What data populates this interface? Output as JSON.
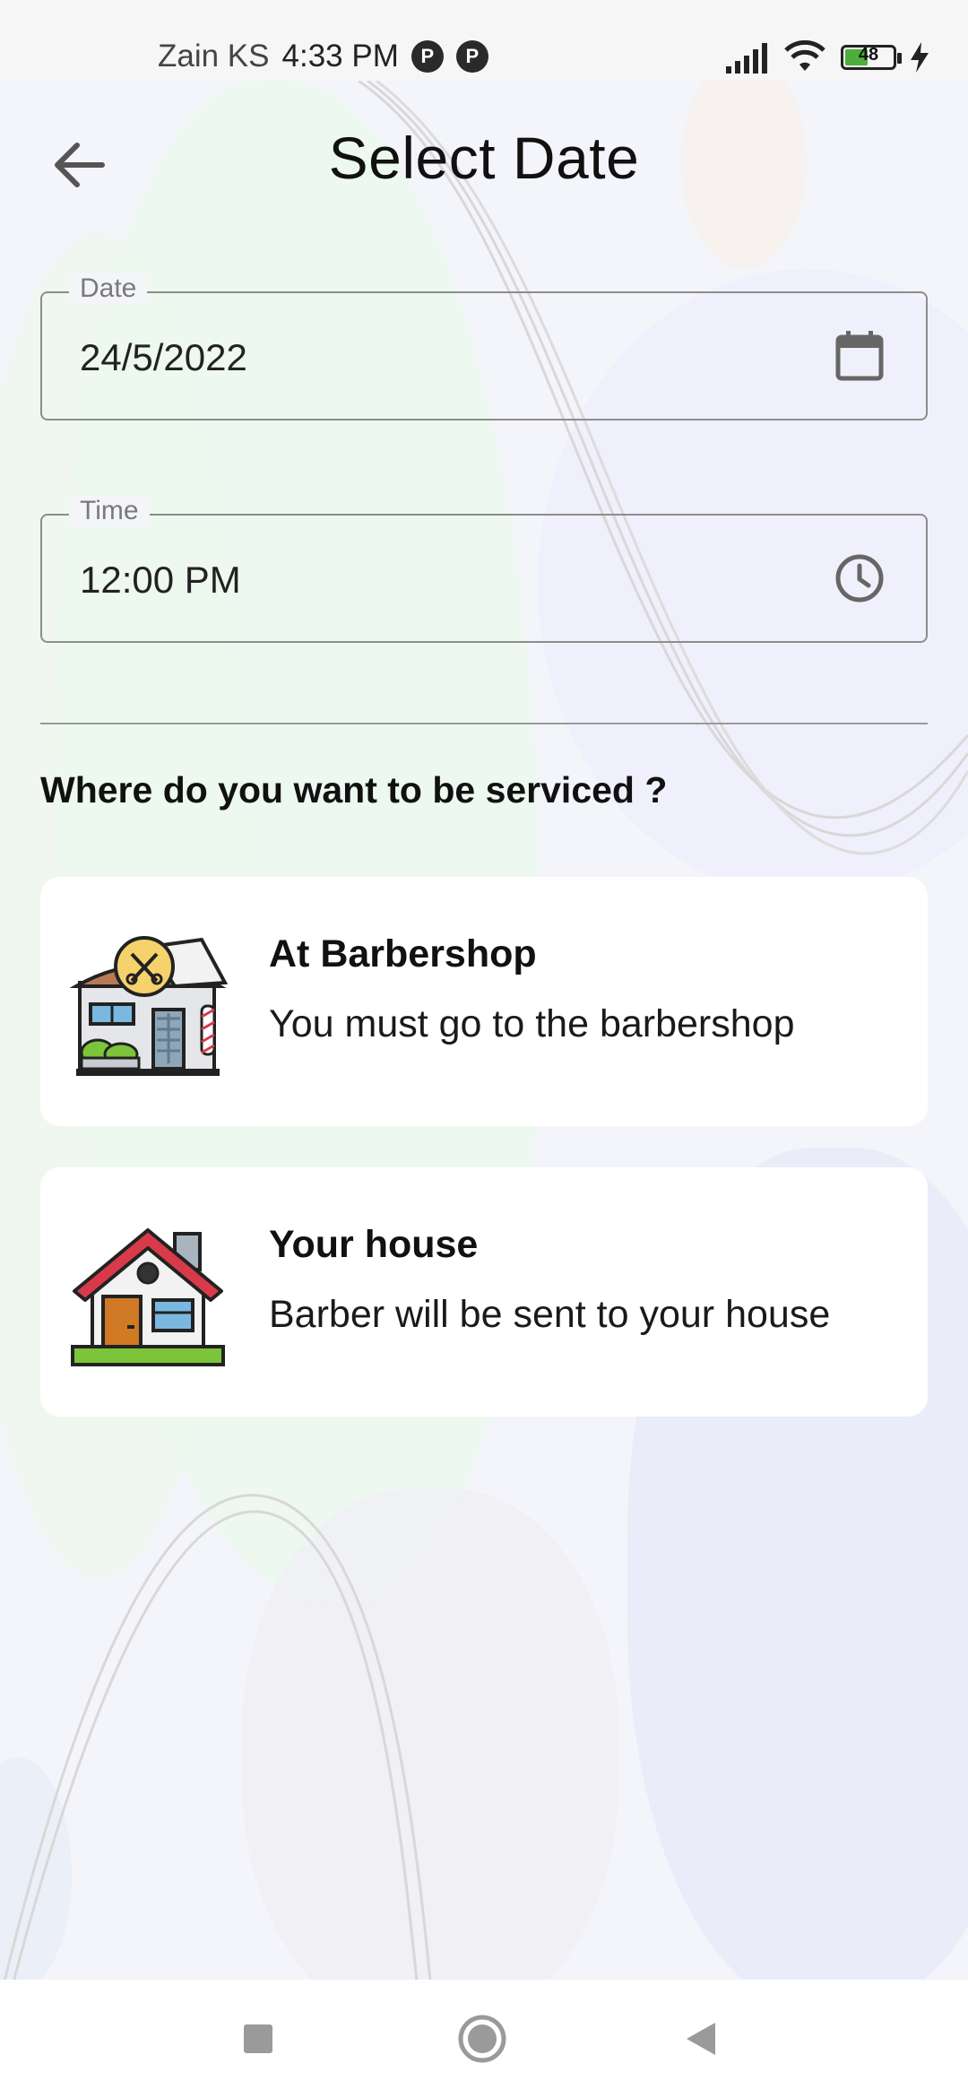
{
  "status_bar": {
    "carrier": "Zain KS",
    "time": "4:33 PM",
    "battery": "48"
  },
  "header": {
    "title": "Select Date",
    "back_icon": "arrow-left-icon"
  },
  "date_field": {
    "label": "Date",
    "value": "24/5/2022",
    "icon": "calendar-icon"
  },
  "time_field": {
    "label": "Time",
    "value": "12:00 PM",
    "icon": "clock-icon"
  },
  "question": "Where do you want to be serviced ?",
  "options": [
    {
      "title": "At Barbershop",
      "subtitle": "You must go to the barbershop",
      "icon": "barbershop-icon"
    },
    {
      "title": "Your house",
      "subtitle": "Barber will be sent to your house",
      "icon": "house-icon"
    }
  ],
  "colors": {
    "background": "#f4f5fa",
    "card": "#ffffff",
    "field_border": "#8d8d8d",
    "house_roof": "#d93a4a",
    "house_door": "#d07a26",
    "grass": "#7cc43a"
  }
}
